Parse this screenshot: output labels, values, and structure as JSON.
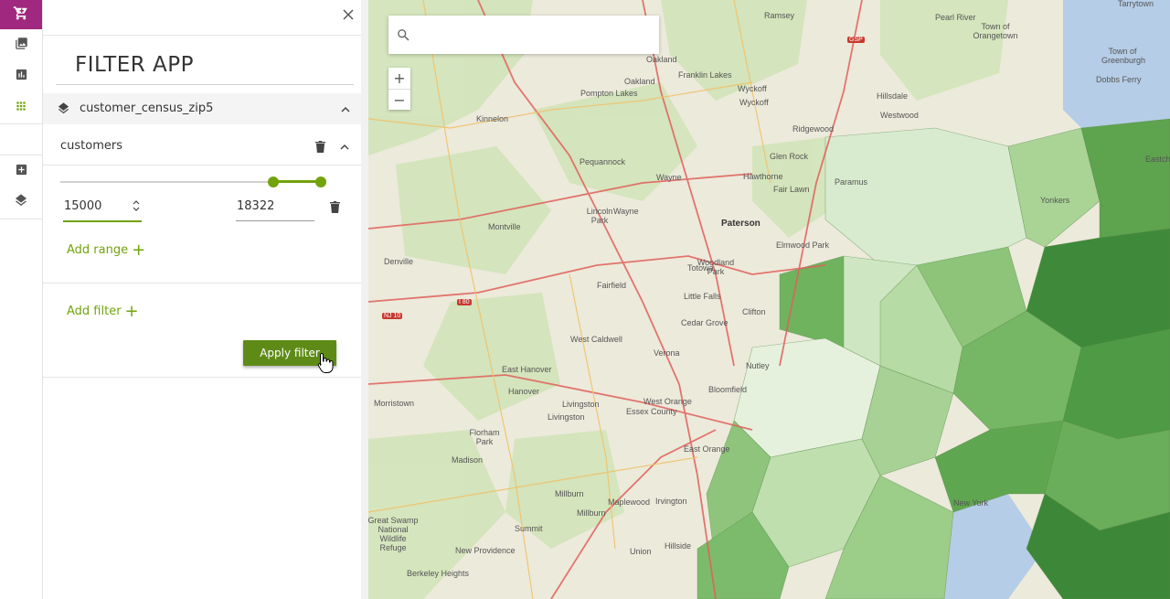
{
  "rail": {
    "items": [
      {
        "icon": "cart-icon",
        "active": true
      },
      {
        "icon": "image-icon",
        "active": false
      },
      {
        "icon": "bar-chart-icon",
        "active": false
      },
      {
        "icon": "apps-grid-icon",
        "active": false
      },
      {
        "icon": "add-box-icon",
        "active": false
      },
      {
        "icon": "layers-icon",
        "active": false
      }
    ],
    "active_color": "#a0287e"
  },
  "panel": {
    "title": "FILTER APP",
    "layer": {
      "name": "customer_census_zip5"
    },
    "filter": {
      "name": "customers",
      "range": {
        "min_value": "15000",
        "max_value": "18322"
      },
      "add_range_label": "Add range",
      "add_filter_label": "Add filter",
      "apply_label": "Apply filter"
    },
    "accent_color": "#72a30c"
  },
  "map": {
    "search": {
      "placeholder": "",
      "value": ""
    },
    "zoom_in": "+",
    "zoom_out": "−",
    "labels": [
      "Ramsey",
      "Pearl River",
      "Tarrytown",
      "Town of Orangetown",
      "Oakland",
      "Franklin Lakes",
      "Town of Greenburgh",
      "Pompton Lakes",
      "Oakland",
      "Wyckoff",
      "Hillsdale",
      "Dobbs Ferry",
      "Kinnelon",
      "Wyckoff",
      "Westwood",
      "Ridgewood",
      "Glen Rock",
      "Pequannock",
      "Hawthorne",
      "Eastchest",
      "Wayne",
      "Fair Lawn",
      "Paramus",
      "Lincoln Park",
      "Wayne",
      "Paterson",
      "Montville",
      "Totowa",
      "Elmwood Park",
      "Yonkers",
      "Woodland Park",
      "Denville",
      "Fairfield",
      "Little Falls",
      "Clifton",
      "Cedar Grove",
      "West Caldwell",
      "Verona",
      "Nutley",
      "East Hanover",
      "Hanover",
      "Livingston",
      "West Orange",
      "Essex County",
      "Morristown",
      "Livingston",
      "Bloomfield",
      "Florham Park",
      "East Orange",
      "Madison",
      "Millburn",
      "Maplewood",
      "Irvington",
      "Summit",
      "Millburn",
      "Great Swamp National Wildlife Refuge",
      "New Providence",
      "Union",
      "Hillside",
      "Berkeley Heights",
      "New York"
    ],
    "highway_labels": [
      "GSP",
      "I 80",
      "NJ 10"
    ]
  }
}
